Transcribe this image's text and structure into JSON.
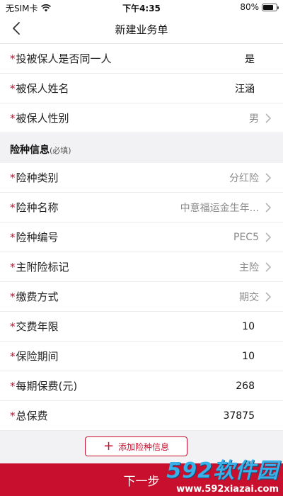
{
  "status_bar": {
    "carrier": "无SIM卡",
    "time": "下午4:35",
    "battery": "80%",
    "battery_level": 0.8
  },
  "nav": {
    "title": "新建业务单"
  },
  "policy_fields": [
    {
      "label": "投被保人是否同一人",
      "value": "是",
      "type": "plain"
    },
    {
      "label": "被保人姓名",
      "value": "汪涵",
      "type": "plain"
    },
    {
      "label": "被保人性别",
      "value": "男",
      "type": "select"
    }
  ],
  "insurance_section": {
    "title": "险种信息",
    "hint": "(必填)"
  },
  "insurance_fields": [
    {
      "label": "险种类别",
      "value": "分红险",
      "type": "select"
    },
    {
      "label": "险种名称",
      "value": "中意福运金生年...",
      "type": "select"
    },
    {
      "label": "险种编号",
      "value": "PEC5",
      "type": "select"
    },
    {
      "label": "主附险标记",
      "value": "主险",
      "type": "select"
    },
    {
      "label": "缴费方式",
      "value": "期交",
      "type": "select"
    },
    {
      "label": "交费年限",
      "value": "10",
      "type": "plain"
    },
    {
      "label": "保险期间",
      "value": "10",
      "type": "plain"
    },
    {
      "label": "每期保费(元)",
      "value": "268",
      "type": "plain"
    },
    {
      "label": "总保费",
      "value": "37875",
      "type": "plain"
    }
  ],
  "add_button": {
    "label": "添加险种信息"
  },
  "next_button": {
    "label": "下一步"
  },
  "watermark": {
    "main": "592软件园",
    "sub": "www.592xiazai.com"
  },
  "colors": {
    "accent": "#c8102e",
    "required_star": "#c8102e"
  }
}
